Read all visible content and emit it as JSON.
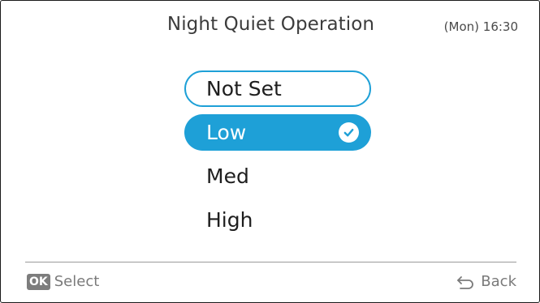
{
  "header": {
    "title": "Night Quiet Operation",
    "clock": "(Mon) 16:30"
  },
  "options": [
    {
      "label": "Not Set",
      "focused": true,
      "selected": false
    },
    {
      "label": "Low",
      "focused": false,
      "selected": true
    },
    {
      "label": "Med",
      "focused": false,
      "selected": false
    },
    {
      "label": "High",
      "focused": false,
      "selected": false
    }
  ],
  "footer": {
    "ok_badge": "OK",
    "select_label": "Select",
    "back_label": "Back"
  },
  "colors": {
    "accent": "#1ea0d7",
    "badge": "#7d7d7d"
  },
  "icons": {
    "selected_marker": "check-circle-icon",
    "back": "back-arrow-icon"
  }
}
